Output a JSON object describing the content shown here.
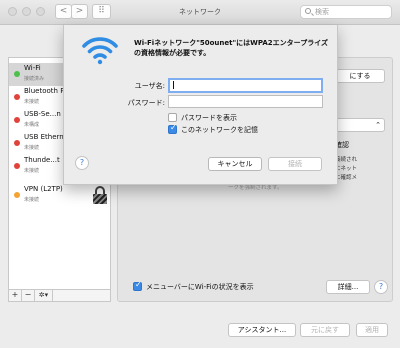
{
  "window": {
    "title": "ネットワーク",
    "back_glyph": "<",
    "forward_glyph": ">",
    "grid_glyph": "⠿",
    "search_placeholder": "検索"
  },
  "sidebar": {
    "items": [
      {
        "name": "Wi-Fi",
        "status": "接続済み",
        "color": "#4cc04a"
      },
      {
        "name": "Bluetooth PAN",
        "status": "未接続",
        "color": "#e0433a"
      },
      {
        "name": "USB-Se...n",
        "status": "未構成",
        "color": "#e0433a"
      },
      {
        "name": "USB Ethernet",
        "status": "未接続",
        "color": "#e0433a"
      },
      {
        "name": "Thunde...t",
        "status": "未接続",
        "color": "#e0433a"
      },
      {
        "name": "VPN (L2TP)",
        "status": "未接続",
        "color": "#f3a434"
      }
    ],
    "add_label": "+",
    "remove_label": "−",
    "action_label": "✲▾"
  },
  "panel": {
    "turn_off_button": "にする",
    "join_label": "に確認",
    "info_lines": [
      "接続され",
      "にネット",
      "に確認メ"
    ],
    "hidden_line": "ークを強制されます。",
    "show_wifi_status_label": "メニューバーにWi-Fiの状況を表示",
    "show_wifi_status_checked": true,
    "advanced_button": "詳細...",
    "help_glyph": "?"
  },
  "footer": {
    "assistant_button": "アシスタント...",
    "revert_button": "元に戻す",
    "apply_button": "適用"
  },
  "sheet": {
    "prompt": "Wi-Fiネットワーク\"50ounet\"にはWPA2エンタープライズの資格情報が必要です。",
    "username_label": "ユーザ名:",
    "username_value": "",
    "password_label": "パスワード:",
    "password_value": "",
    "show_password_label": "パスワードを表示",
    "show_password_checked": false,
    "remember_label": "このネットワークを記憶",
    "remember_checked": true,
    "cancel_button": "キャンセル",
    "join_button": "接続",
    "help_glyph": "?"
  },
  "colors": {
    "accent": "#3b8ae6",
    "wifi_icon": "#2f8de4"
  }
}
